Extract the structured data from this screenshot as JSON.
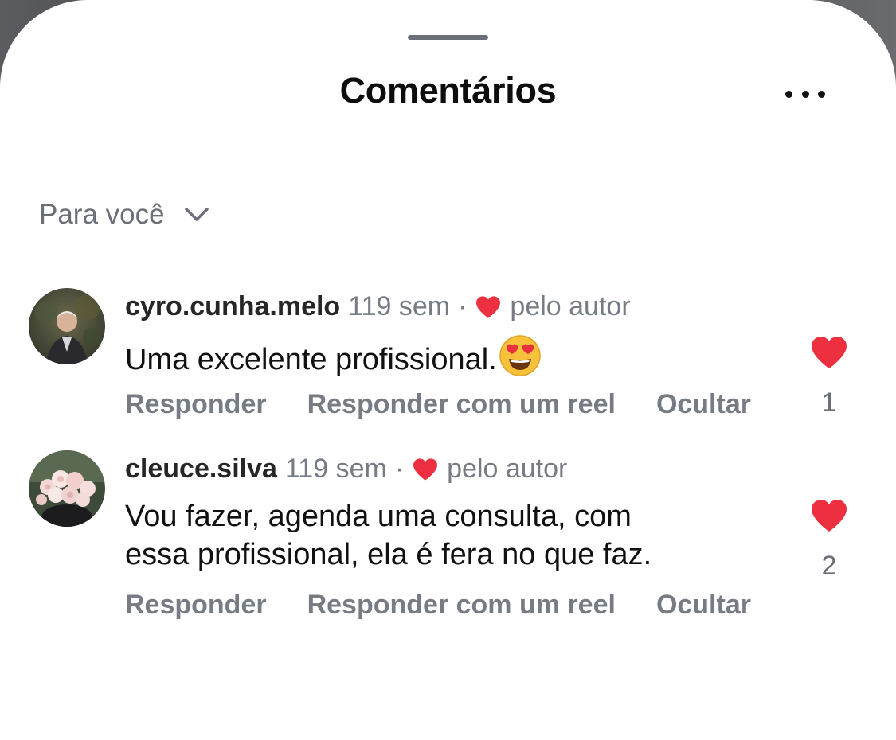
{
  "sheet": {
    "title": "Comentários",
    "sort_label": "Para você"
  },
  "comments": [
    {
      "username": "cyro.cunha.melo",
      "time": "119 sem",
      "separator": "·",
      "badge": "pelo autor",
      "text": "Uma excelente profissional.",
      "emoji": "smiling-face-with-heart-eyes",
      "actions": [
        "Responder",
        "Responder com um reel",
        "Ocultar"
      ],
      "likes": "1",
      "liked": true
    },
    {
      "username": "cleuce.silva",
      "time": "119 sem",
      "separator": "·",
      "badge": "pelo autor",
      "text_line1": "Vou fazer, agenda uma consulta, com",
      "text_line2": "essa profissional, ela é fera no que faz.",
      "actions": [
        "Responder",
        "Responder com um reel",
        "Ocultar"
      ],
      "likes": "2",
      "liked": true
    }
  ],
  "colors": {
    "heart": "#ed3040",
    "muted_text": "#777c84",
    "username": "#262626"
  },
  "icons": {
    "more": "more-horizontal-icon",
    "sort": "chevron-down-icon",
    "like": "heart-filled-icon"
  }
}
